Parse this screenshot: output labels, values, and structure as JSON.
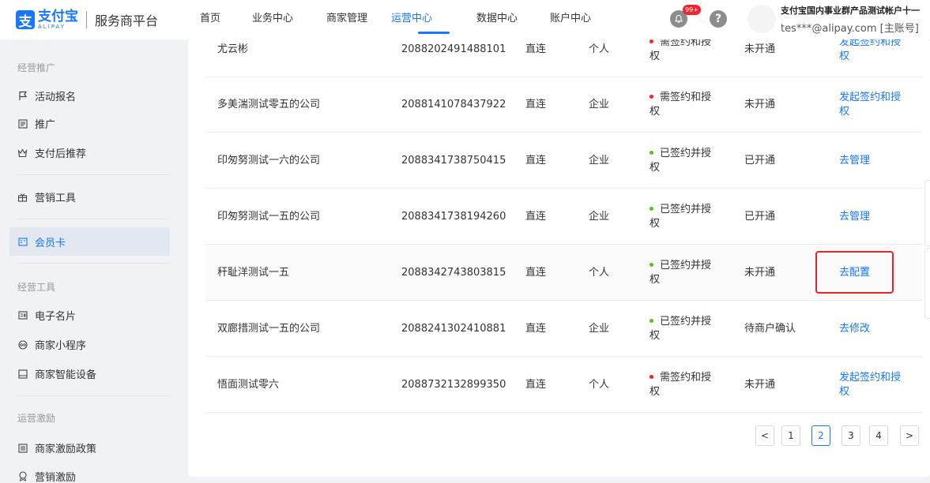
{
  "header": {
    "logo_mark": "支",
    "logo_cn": "支付宝",
    "logo_en": "ALIPAY",
    "platform": "服务商平台",
    "nav": [
      "首页",
      "业务中心",
      "商家管理",
      "运营中心",
      "数据中心",
      "账户中心"
    ],
    "active_nav": "运营中心",
    "badge": "99+",
    "help": "?",
    "user_name": "支付宝国内事业群产品测试帐户十一",
    "user_email": "tes***@alipay.com [主账号]"
  },
  "sidebar": {
    "group1": "经营推广",
    "group2": "经营工具",
    "group3": "运营激励",
    "items": [
      {
        "label": "活动报名",
        "icon": "flag-icon"
      },
      {
        "label": "推广",
        "icon": "document-icon"
      },
      {
        "label": "支付后推荐",
        "icon": "crown-icon"
      },
      {
        "label": "营销工具",
        "icon": "gift-icon"
      },
      {
        "label": "会员卡",
        "icon": "card-icon"
      },
      {
        "label": "电子名片",
        "icon": "id-card-icon"
      },
      {
        "label": "商家小程序",
        "icon": "mini-program-icon"
      },
      {
        "label": "商家智能设备",
        "icon": "device-icon"
      },
      {
        "label": "商家激励政策",
        "icon": "policy-icon"
      },
      {
        "label": "营销激励",
        "icon": "reward-icon"
      }
    ],
    "active_item": "会员卡"
  },
  "table": {
    "rows": [
      {
        "name": "尤云彬",
        "id": "2088202491488101",
        "connection": "直连",
        "type": "个人",
        "status_line1": "需签约和授",
        "status_line2": "权",
        "status_color": "red",
        "open": "未开通",
        "action_line1": "发起签约和授",
        "action_line2": "权"
      },
      {
        "name": "多美湍测试零五的公司",
        "id": "2088141078437922",
        "connection": "直连",
        "type": "企业",
        "status_line1": "需签约和授",
        "status_line2": "权",
        "status_color": "red",
        "open": "未开通",
        "action_line1": "发起签约和授",
        "action_line2": "权"
      },
      {
        "name": "印匆努测试一六的公司",
        "id": "2088341738750415",
        "connection": "直连",
        "type": "企业",
        "status_line1": "已签约并授",
        "status_line2": "权",
        "status_color": "green",
        "open": "已开通",
        "action_line1": "去管理",
        "action_line2": ""
      },
      {
        "name": "印匆努测试一五的公司",
        "id": "2088341738194260",
        "connection": "直连",
        "type": "企业",
        "status_line1": "已签约并授",
        "status_line2": "权",
        "status_color": "green",
        "open": "已开通",
        "action_line1": "去管理",
        "action_line2": ""
      },
      {
        "name": "秆耻洋测试一五",
        "id": "2088342743803815",
        "connection": "直连",
        "type": "个人",
        "status_line1": "已签约并授",
        "status_line2": "权",
        "status_color": "green",
        "open": "未开通",
        "action_line1": "去配置",
        "action_line2": ""
      },
      {
        "name": "双廊措测试一五的公司",
        "id": "2088241302410881",
        "connection": "直连",
        "type": "企业",
        "status_line1": "已签约并授",
        "status_line2": "权",
        "status_color": "green",
        "open": "待商户确认",
        "action_line1": "去修改",
        "action_line2": ""
      },
      {
        "name": "悟面测试零六",
        "id": "2088732132899350",
        "connection": "直连",
        "type": "个人",
        "status_line1": "需签约和授",
        "status_line2": "权",
        "status_color": "red",
        "open": "未开通",
        "action_line1": "发起签约和授",
        "action_line2": "权"
      }
    ]
  },
  "pagination": {
    "prev": "<",
    "pages": [
      "1",
      "2",
      "3",
      "4"
    ],
    "current": "2",
    "next": ">"
  }
}
